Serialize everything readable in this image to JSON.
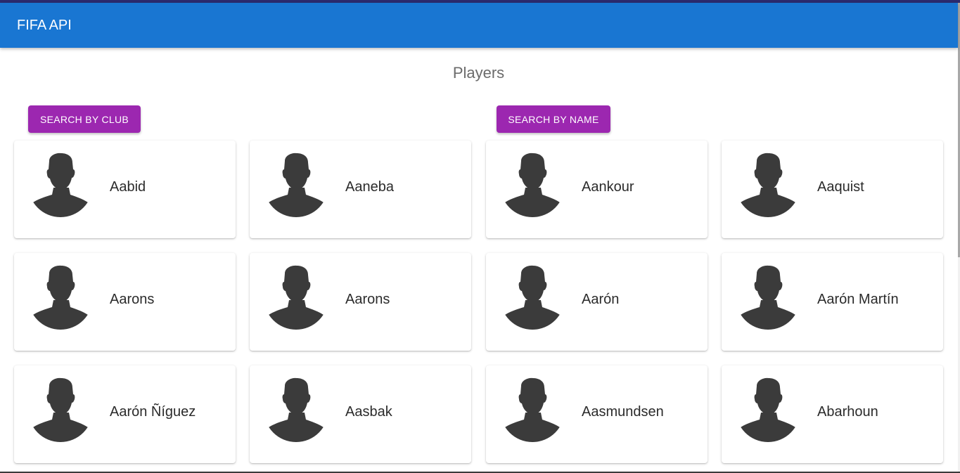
{
  "app_bar": {
    "title": "FIFA API",
    "color": "#1976d2"
  },
  "page": {
    "heading": "Players"
  },
  "buttons": {
    "search_club": "SEARCH BY CLUB",
    "search_name": "SEARCH BY NAME",
    "color": "#9c27b0"
  },
  "players": [
    {
      "name": "Aabid",
      "icon": "player-silhouette-icon"
    },
    {
      "name": "Aaneba",
      "icon": "player-silhouette-icon"
    },
    {
      "name": "Aankour",
      "icon": "player-silhouette-icon"
    },
    {
      "name": "Aaquist",
      "icon": "player-silhouette-icon"
    },
    {
      "name": "Aarons",
      "icon": "player-silhouette-icon"
    },
    {
      "name": "Aarons",
      "icon": "player-silhouette-icon"
    },
    {
      "name": "Aarón",
      "icon": "player-silhouette-icon"
    },
    {
      "name": "Aarón Martín",
      "icon": "player-silhouette-icon"
    },
    {
      "name": "Aarón Ñíguez",
      "icon": "player-silhouette-icon"
    },
    {
      "name": "Aasbak",
      "icon": "player-silhouette-icon"
    },
    {
      "name": "Aasmundsen",
      "icon": "player-silhouette-icon"
    },
    {
      "name": "Abarhoun",
      "icon": "player-silhouette-icon"
    }
  ]
}
